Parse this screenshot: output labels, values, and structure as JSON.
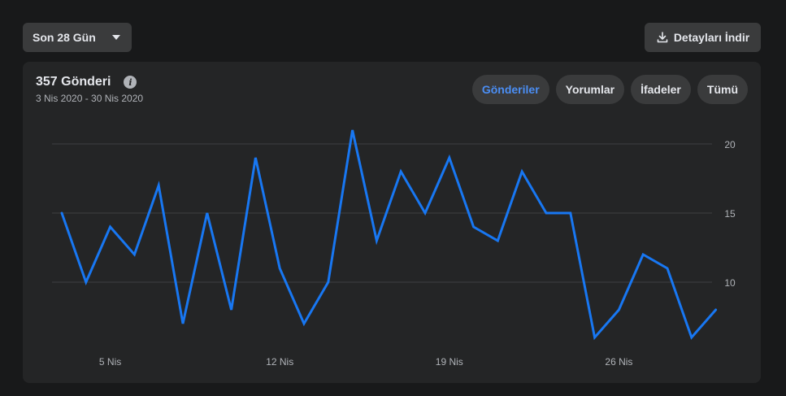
{
  "toolbar": {
    "range_label": "Son 28 Gün",
    "download_label": "Detayları İndir"
  },
  "card": {
    "title": "357 Gönderi",
    "subtitle": "3 Nis 2020 - 30 Nis 2020",
    "tabs": [
      {
        "label": "Gönderiler",
        "active": true
      },
      {
        "label": "Yorumlar",
        "active": false
      },
      {
        "label": "İfadeler",
        "active": false
      },
      {
        "label": "Tümü",
        "active": false
      }
    ]
  },
  "colors": {
    "line": "#1877f2",
    "grid": "#3e4042",
    "tick": "#b0b3b8"
  },
  "chart_data": {
    "type": "line",
    "x": [
      "3 Nis",
      "4 Nis",
      "5 Nis",
      "6 Nis",
      "7 Nis",
      "8 Nis",
      "9 Nis",
      "10 Nis",
      "11 Nis",
      "12 Nis",
      "13 Nis",
      "14 Nis",
      "15 Nis",
      "16 Nis",
      "17 Nis",
      "18 Nis",
      "19 Nis",
      "20 Nis",
      "21 Nis",
      "22 Nis",
      "23 Nis",
      "24 Nis",
      "25 Nis",
      "26 Nis",
      "27 Nis",
      "28 Nis",
      "29 Nis",
      "30 Nis"
    ],
    "values": [
      15,
      10,
      14,
      12,
      17,
      7,
      15,
      8,
      19,
      11,
      7,
      10,
      21,
      13,
      18,
      15,
      19,
      14,
      13,
      18,
      15,
      15,
      6,
      8,
      12,
      11,
      6,
      8
    ],
    "xticks": [
      "5 Nis",
      "12 Nis",
      "19 Nis",
      "26 Nis"
    ],
    "yticks": [
      10,
      15,
      20
    ],
    "ylim": [
      5,
      22
    ],
    "grid": true
  }
}
